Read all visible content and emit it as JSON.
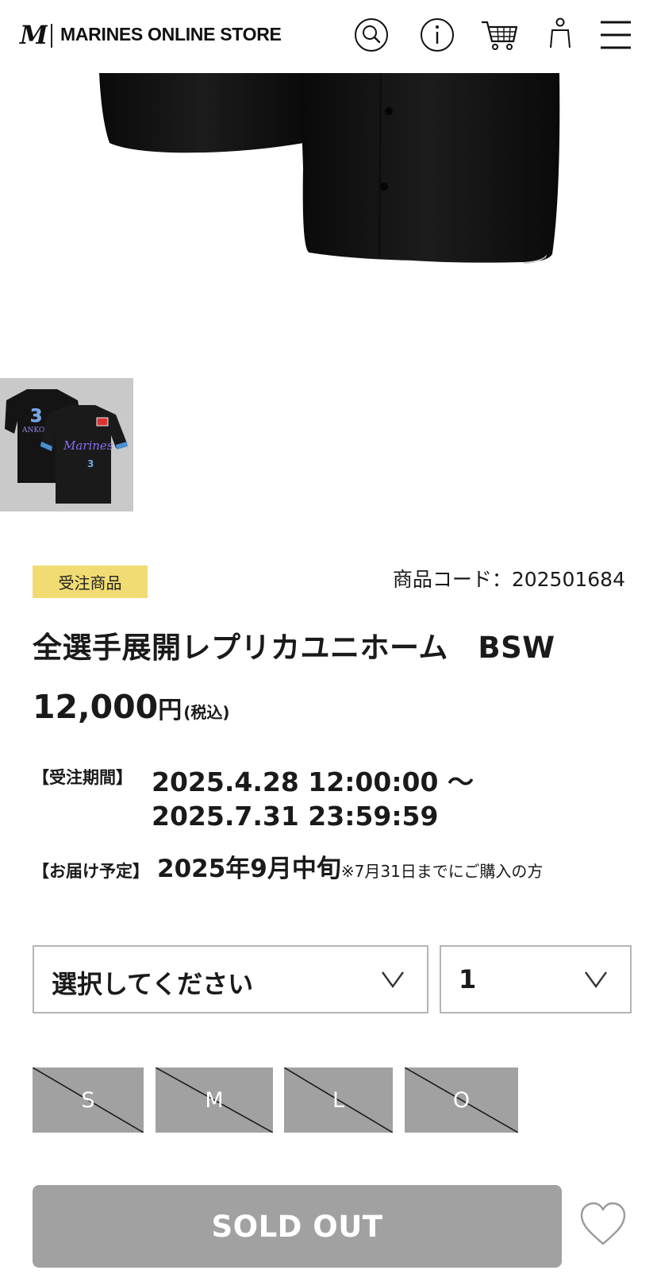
{
  "header": {
    "store_name": "MARINES ONLINE STORE",
    "icons": [
      "search-icon",
      "info-icon",
      "cart-icon",
      "account-icon",
      "menu-icon"
    ]
  },
  "product": {
    "badge": "受注商品",
    "code": "商品コード：202501684",
    "name": "全選手展開レプリカユニホーム　BSW",
    "price_value": "12,000",
    "price_unit": "円",
    "price_tax": "(税込)",
    "order_period_label": "【受注期間】",
    "order_period_start": "2025.4.28  12:00:00 ～",
    "order_period_end": "2025.7.31  23:59:59",
    "delivery_label": "【お届け予定】",
    "delivery_value": "2025年9月中旬",
    "delivery_note": "※7月31日までにご購入の方"
  },
  "thumbnail": {
    "jersey_text": "Marines",
    "player_name": "ANKOWIKA",
    "number": "3"
  },
  "options": {
    "size_select_placeholder": "選択してください",
    "quantity_value": "1"
  },
  "sizes": [
    "S",
    "M",
    "L",
    "O"
  ],
  "actions": {
    "soldout_label": "SOLD OUT"
  },
  "colors": {
    "badge": "#f0dc73",
    "disabled": "#a1a1a1",
    "jersey": "#111111",
    "accent_purple": "#7b5fd6",
    "accent_blue": "#5aa0d8"
  }
}
